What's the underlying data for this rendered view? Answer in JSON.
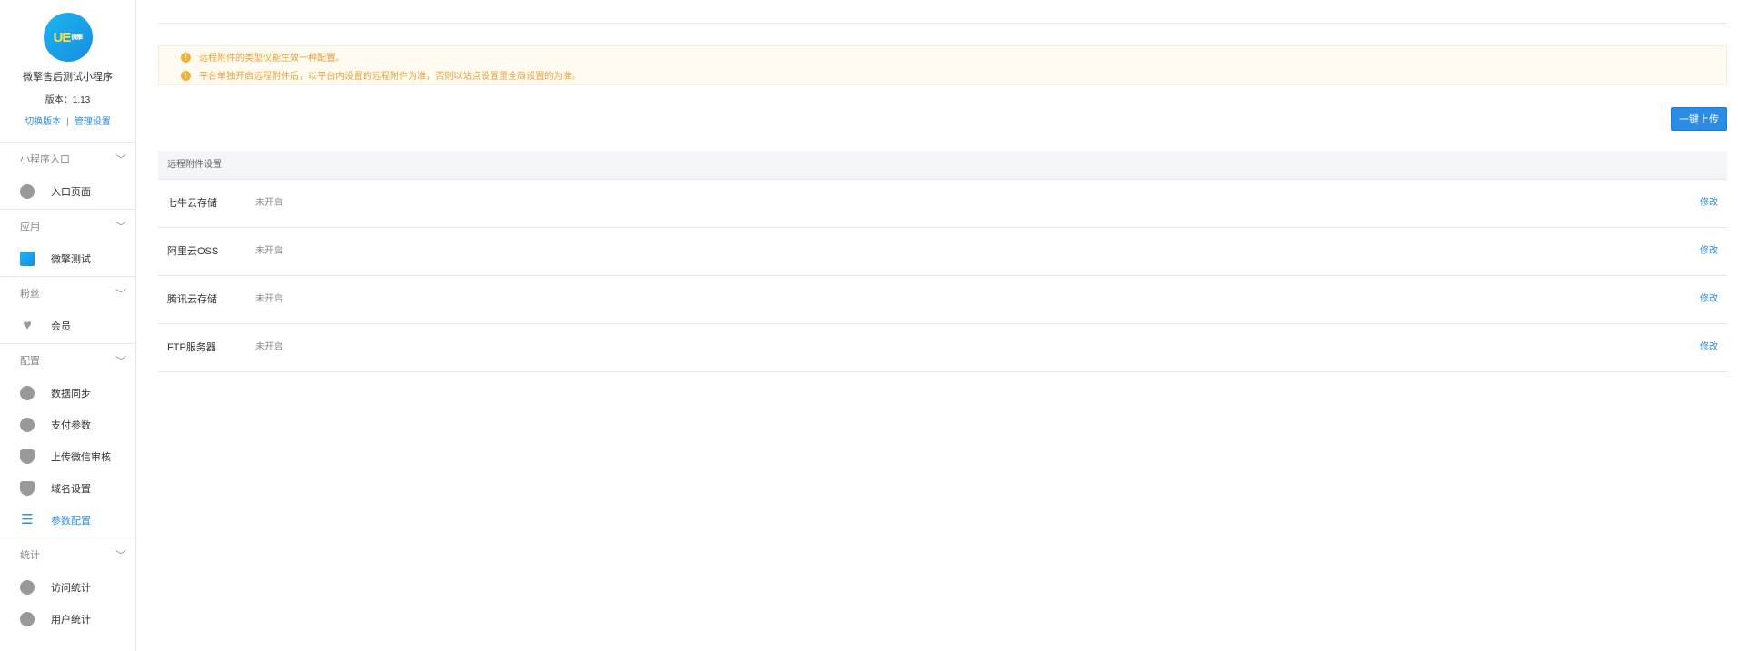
{
  "sidebar": {
    "logo_text": "UE",
    "logo_small": "微擎",
    "app_name": "微擎售后测试小程序",
    "version": "版本：1.13",
    "switch_version": "切换版本",
    "separator": "|",
    "manage_settings": "管理设置",
    "groups": [
      {
        "title": "小程序入口",
        "items": [
          {
            "label": "入口页面",
            "icon": "link-icon"
          }
        ]
      },
      {
        "title": "应用",
        "items": [
          {
            "label": "微擎测试",
            "icon": "app-icon"
          }
        ]
      },
      {
        "title": "粉丝",
        "items": [
          {
            "label": "会员",
            "icon": "heart-icon"
          }
        ]
      },
      {
        "title": "配置",
        "items": [
          {
            "label": "数据同步",
            "icon": "link-icon"
          },
          {
            "label": "支付参数",
            "icon": "gear-icon"
          },
          {
            "label": "上传微信审核",
            "icon": "shield-icon"
          },
          {
            "label": "域名设置",
            "icon": "shield-icon"
          },
          {
            "label": "参数配置",
            "icon": "list-icon",
            "active": true
          }
        ]
      },
      {
        "title": "统计",
        "items": [
          {
            "label": "访问统计",
            "icon": "chart-icon"
          },
          {
            "label": "用户统计",
            "icon": "chart-icon"
          }
        ]
      }
    ]
  },
  "notice": {
    "lines": [
      "远程附件的类型仅能生效一种配置。",
      "平台单独开启远程附件后，以平台内设置的远程附件为准，否则以站点设置里全局设置的为准。"
    ]
  },
  "upload_button": "一键上传",
  "table": {
    "header": "远程附件设置",
    "rows": [
      {
        "name": "七牛云存储",
        "status": "未开启",
        "action": "修改"
      },
      {
        "name": "阿里云OSS",
        "status": "未开启",
        "action": "修改"
      },
      {
        "name": "腾讯云存储",
        "status": "未开启",
        "action": "修改"
      },
      {
        "name": "FTP服务器",
        "status": "未开启",
        "action": "修改"
      }
    ]
  },
  "colors": {
    "accent": "#2a8ce4",
    "warning": "#e6a23c",
    "notice_bg": "#fffbf0"
  }
}
